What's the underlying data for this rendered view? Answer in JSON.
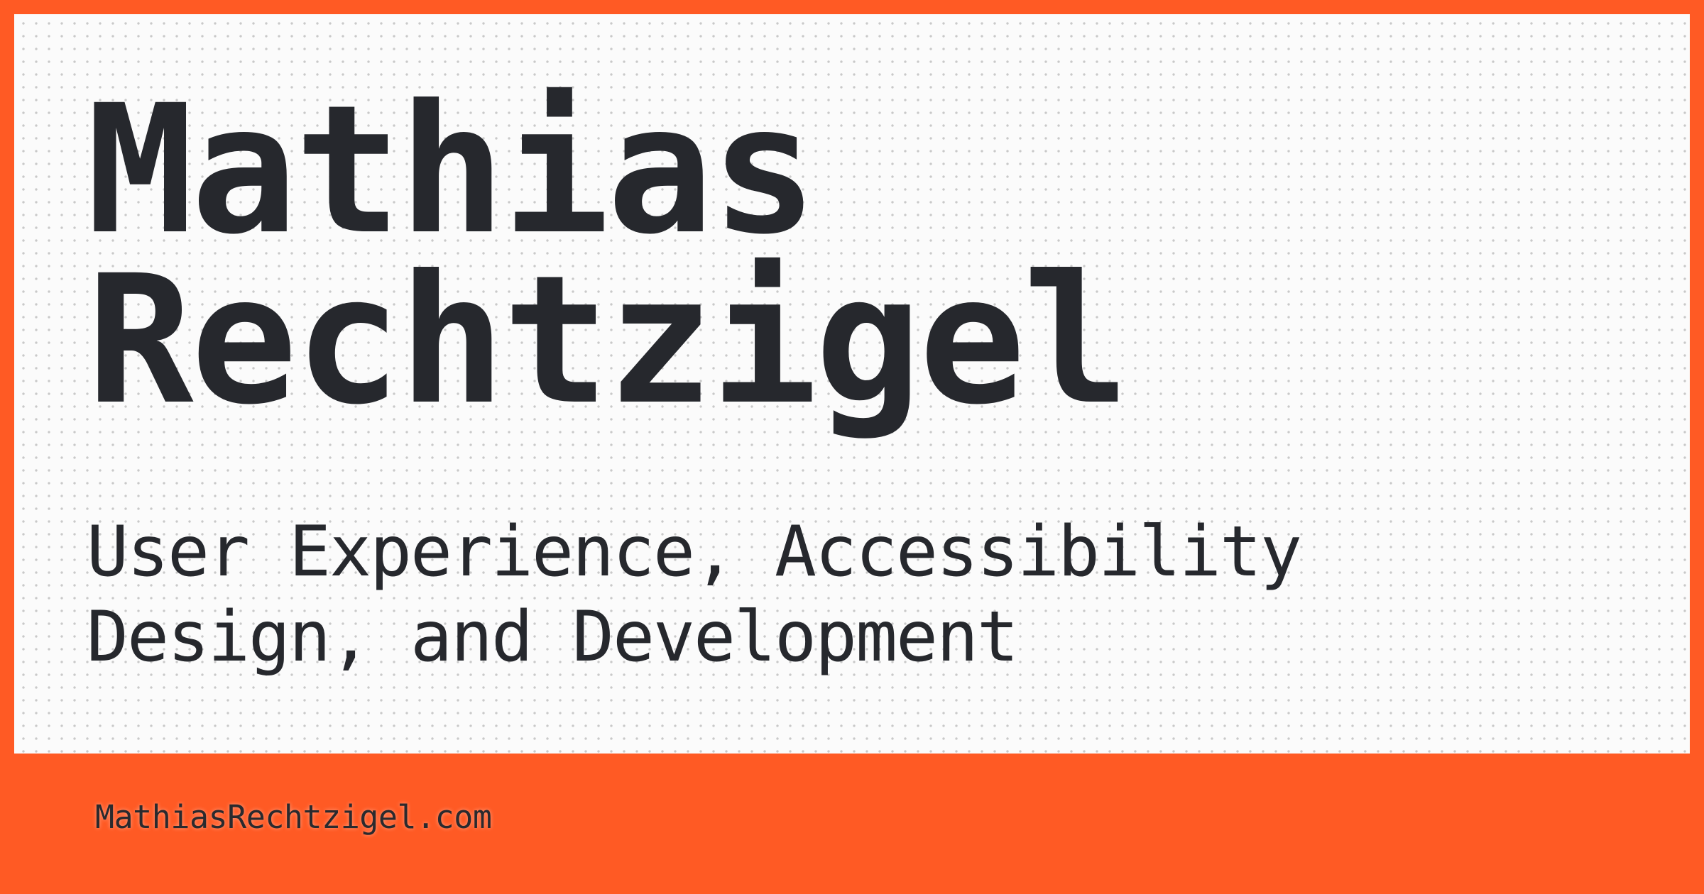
{
  "colors": {
    "frame": "#ff5a24",
    "card_background": "#fbfbfb",
    "dot_pattern": "#c9c9c9",
    "text": "#26282d"
  },
  "card": {
    "name_line_1": "Mathias",
    "name_line_2": "Rechtzigel",
    "tagline_line_1": "User Experience, Accessibility",
    "tagline_line_2": "Design, and Development"
  },
  "footer": {
    "url": "MathiasRechtzigel.com"
  }
}
